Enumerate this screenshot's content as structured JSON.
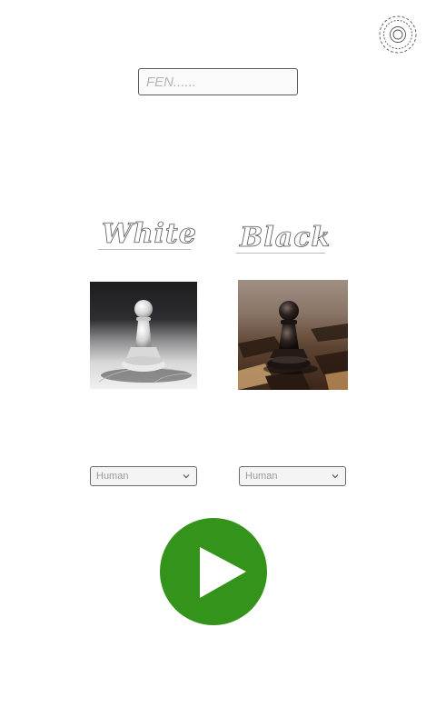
{
  "header": {
    "settings_icon": "gear-icon"
  },
  "fen": {
    "value": "",
    "placeholder": "FEN......"
  },
  "white_side": {
    "title": "White",
    "image": "white-pawn-image",
    "player_select": {
      "selected": "Human",
      "icon": "chevron-down-icon"
    }
  },
  "black_side": {
    "title": "Black",
    "image": "black-pawn-image",
    "player_select": {
      "selected": "Human",
      "icon": "chevron-down-icon"
    }
  },
  "play": {
    "icon": "play-icon",
    "color": "#33931a"
  }
}
